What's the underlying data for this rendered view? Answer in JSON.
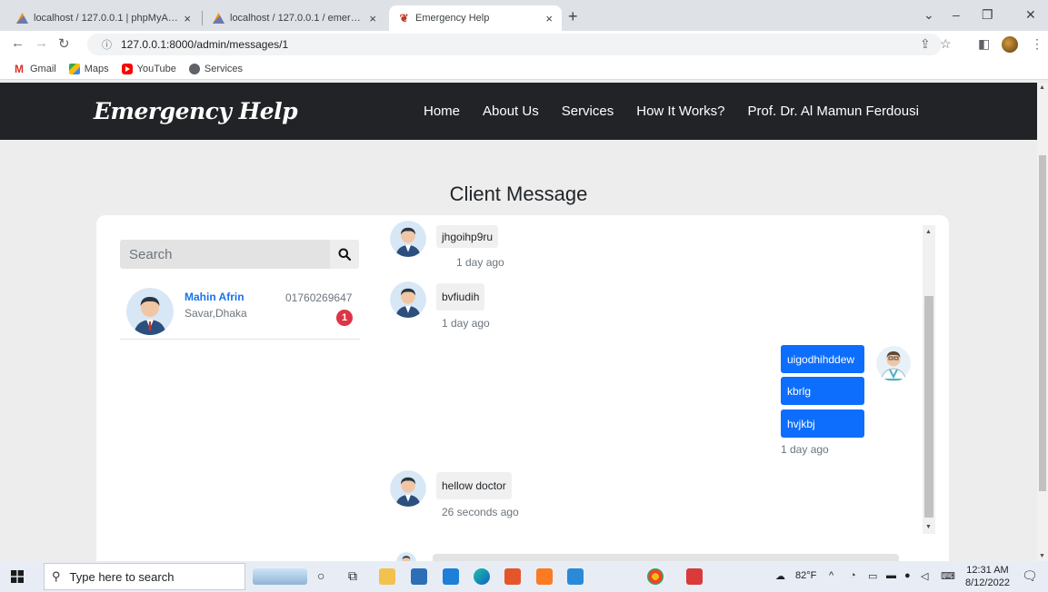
{
  "browser": {
    "tabs": [
      {
        "title": "localhost / 127.0.0.1 | phpMyAdn",
        "close": "×"
      },
      {
        "title": "localhost / 127.0.0.1 / emergenc",
        "close": "×"
      },
      {
        "title": "Emergency Help",
        "close": "×"
      }
    ],
    "new_tab": "+",
    "url": "127.0.0.1:8000/admin/messages/1",
    "bookmarks": [
      {
        "label": "Gmail",
        "icon": "gmail-icon"
      },
      {
        "label": "Maps",
        "icon": "maps-icon"
      },
      {
        "label": "YouTube",
        "icon": "youtube-icon"
      },
      {
        "label": "Services",
        "icon": "services-icon"
      }
    ]
  },
  "site": {
    "brand": "Emergency Help",
    "nav": [
      "Home",
      "About Us",
      "Services",
      "How It Works?",
      "Prof. Dr. Al Mamun Ferdousi"
    ]
  },
  "page": {
    "title": "Client Message",
    "search_placeholder": "Search"
  },
  "contact": {
    "name": "Mahin Afrin",
    "location": "Savar,Dhaka",
    "phone": "01760269647",
    "unread": "1"
  },
  "messages": {
    "m1_text": "jhgoihp9ru",
    "m1_time": "1 day ago",
    "m2_text": "bvfiudih",
    "m2_time": "1 day ago",
    "sent": [
      "uigodhihddew",
      "kbrlg",
      "hvjkbj"
    ],
    "sent_time": "1 day ago",
    "m3_text": "hellow doctor",
    "m3_time": "26 seconds ago"
  },
  "taskbar": {
    "search_placeholder": "Type here to search",
    "weather": "82°F",
    "time": "12:31 AM",
    "date": "8/12/2022"
  },
  "colors": {
    "navbar": "#222326",
    "accent_blue": "#0d6efd",
    "link_blue": "#1a73e8",
    "badge_red": "#dc3545",
    "page_bg": "#ededed"
  }
}
